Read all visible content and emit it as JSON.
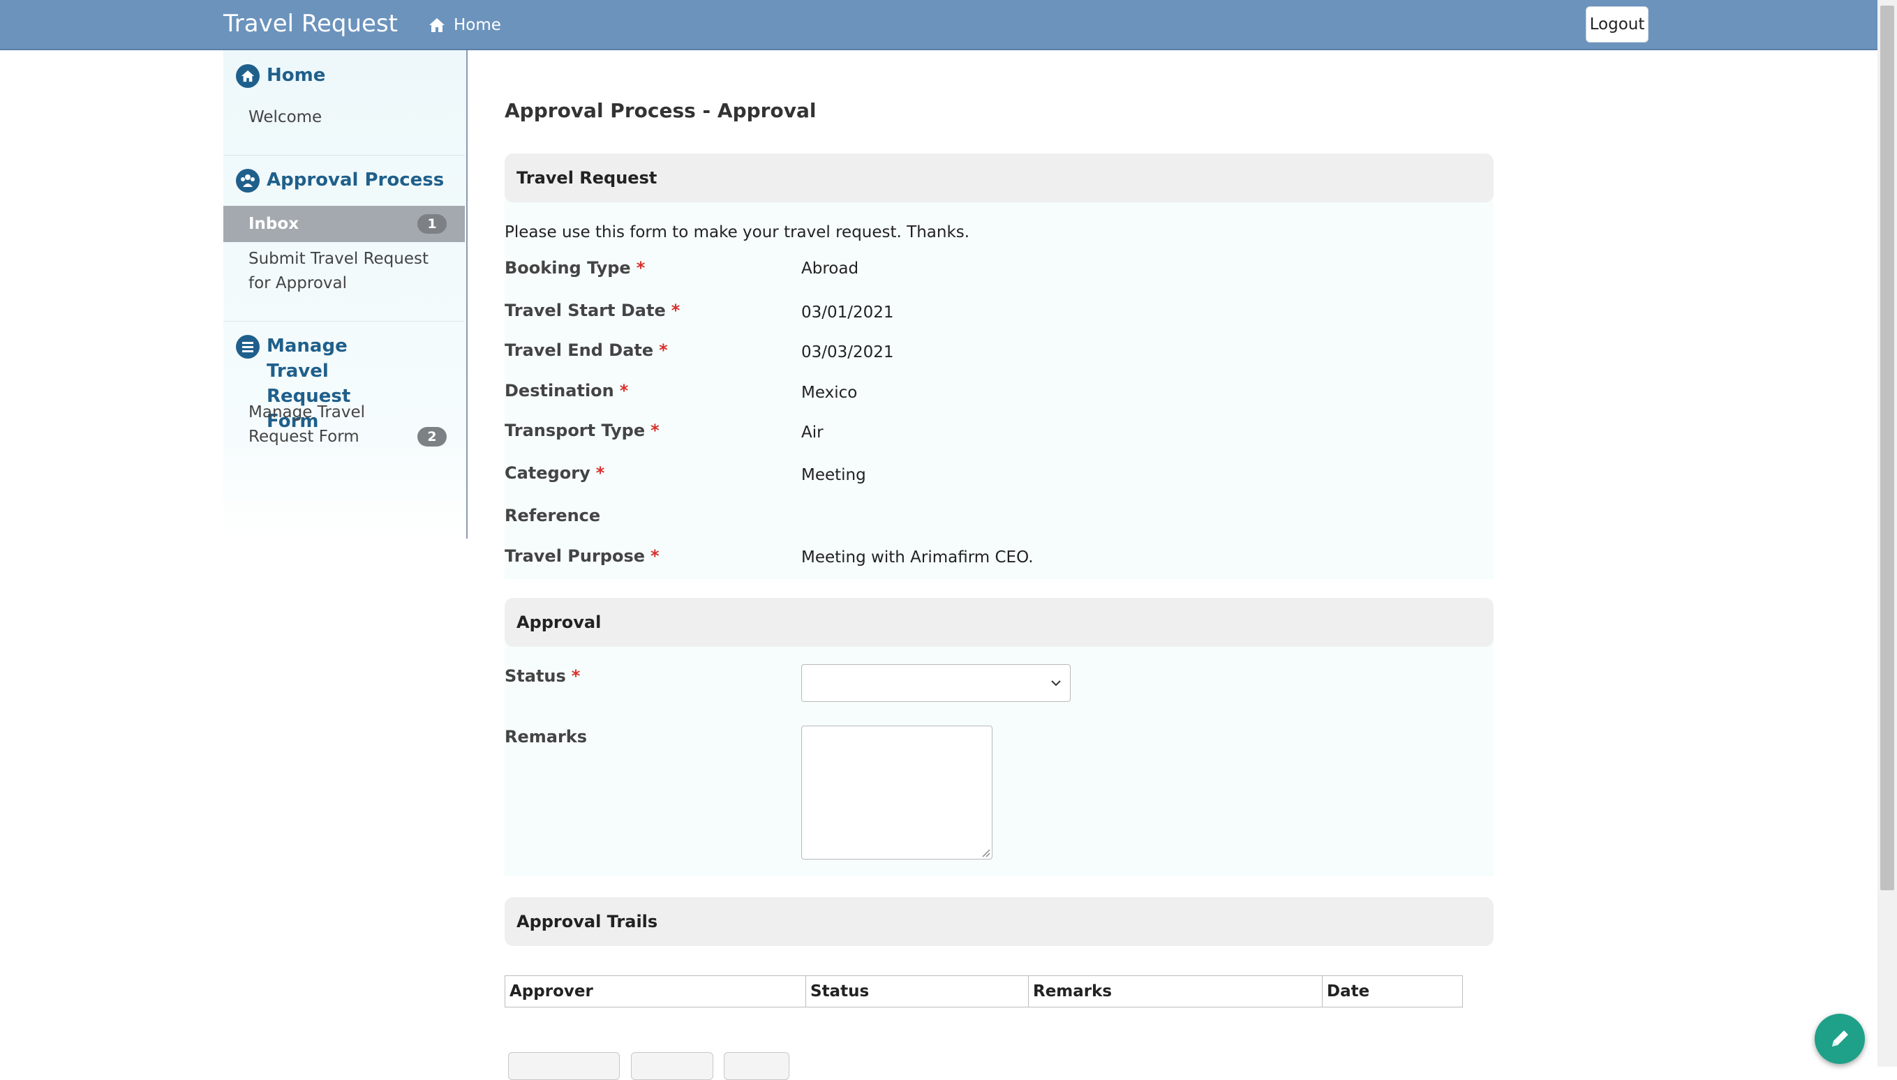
{
  "navbar": {
    "brand": "Travel Request",
    "home_label": "Home",
    "logout_label": "Logout",
    "color": "#6b93bc"
  },
  "sidebar": {
    "sections": [
      {
        "title": "Home",
        "icon": "home-icon",
        "items": [
          {
            "label": "Welcome"
          }
        ]
      },
      {
        "title": "Approval Process",
        "icon": "users-icon",
        "items": [
          {
            "label": "Inbox",
            "badge": "1",
            "active": true
          },
          {
            "label": "Submit Travel Request for Approval"
          }
        ]
      },
      {
        "title": "Manage Travel Request Form",
        "icon": "list-icon",
        "items": [
          {
            "label": "Manage Travel Request Form",
            "badge": "2"
          }
        ]
      }
    ]
  },
  "main": {
    "page_title": "Approval Process - Approval",
    "travel_request": {
      "heading": "Travel Request",
      "intro": "Please use this form to make your travel request. Thanks.",
      "fields": [
        {
          "label": "Booking Type",
          "required": true,
          "value": "Abroad"
        },
        {
          "label": "Travel Start Date",
          "required": true,
          "value": "03/01/2021"
        },
        {
          "label": "Travel End Date",
          "required": true,
          "value": "03/03/2021"
        },
        {
          "label": "Destination",
          "required": true,
          "value": "Mexico"
        },
        {
          "label": "Transport Type",
          "required": true,
          "value": "Air"
        },
        {
          "label": "Category",
          "required": true,
          "value": "Meeting"
        },
        {
          "label": "Reference",
          "required": false,
          "value": ""
        },
        {
          "label": "Travel Purpose",
          "required": true,
          "value": "Meeting with Arimafirm CEO."
        }
      ]
    },
    "approval": {
      "heading": "Approval",
      "status_label": "Status",
      "status_value": "",
      "remarks_label": "Remarks",
      "remarks_value": ""
    },
    "approval_trails": {
      "heading": "Approval Trails",
      "columns": [
        "Approver",
        "Status",
        "Remarks",
        "Date"
      ]
    }
  },
  "colors": {
    "required": "#d9302c",
    "sidebar_heading": "#1f5f8b",
    "fab": "#1fa089"
  }
}
